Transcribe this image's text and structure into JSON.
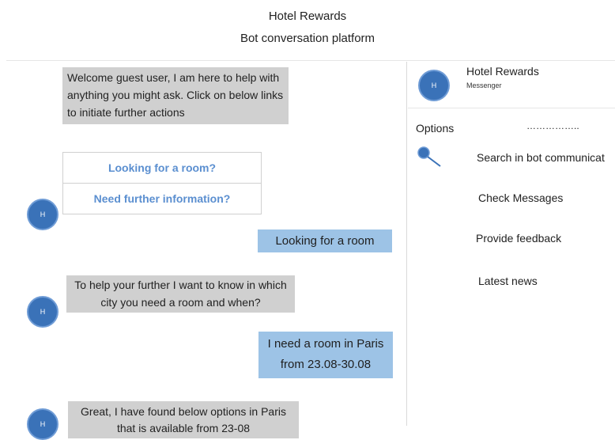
{
  "header": {
    "title": "Hotel Rewards",
    "subtitle": "Bot conversation platform"
  },
  "conversation": {
    "avatar_letter": "H",
    "messages": [
      {
        "from": "bot",
        "text": "Welcome guest user, I am here to help with anything you might ask. Click on below links to initiate further actions"
      },
      {
        "from": "user",
        "text": "Looking for a room"
      },
      {
        "from": "bot",
        "text": "To help your further I want to know in which city you need a room and when?"
      },
      {
        "from": "user",
        "line1": "I need a room in Paris",
        "line2": "from 23.08-30.08"
      },
      {
        "from": "bot",
        "line1": "Great, I have found below options in Paris",
        "line2": "that is available from 23-08"
      }
    ],
    "quick_replies": [
      "Looking for a room?",
      "Need further information?"
    ]
  },
  "sidebar": {
    "avatar_letter": "H",
    "name": "Hotel Rewards",
    "subtitle": "Messenger",
    "options_label": "Options",
    "options_dots": "……………..",
    "menu": [
      "Search in bot communicat",
      "Check Messages",
      "Provide feedback",
      "Latest news"
    ]
  },
  "colors": {
    "bot_bubble": "#d0d0d0",
    "user_bubble": "#9dc3e6",
    "avatar": "#3a72b8",
    "link": "#5b8fd0"
  }
}
